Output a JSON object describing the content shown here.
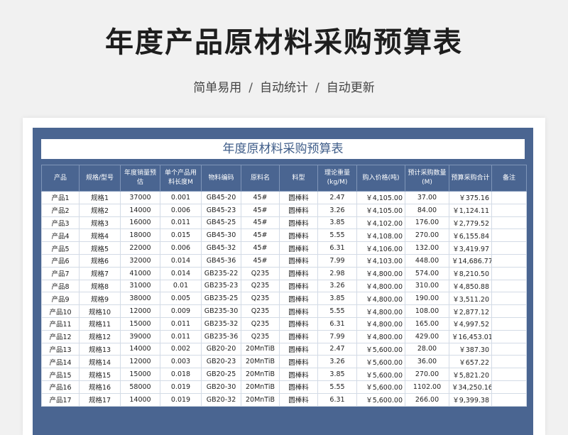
{
  "hero": {
    "title": "年度产品原材料采购预算表",
    "subtitle": [
      "简单易用",
      "自动统计",
      "自动更新"
    ],
    "separator": "/"
  },
  "sheet": {
    "title": "年度原材料采购预算表",
    "accent_color": "#4a6591",
    "columns": [
      "产品",
      "规格/型号",
      "年度销量预估",
      "单个产品用料长度M",
      "物料编码",
      "原料名",
      "料型",
      "理论重量(kg/M)",
      "购入价格(吨)",
      "预计采购数量(M)",
      "预算采购合计",
      "备注"
    ],
    "rows": [
      [
        "产品1",
        "规格1",
        "37000",
        "0.001",
        "GB45-20",
        "45#",
        "圆棒料",
        "2.47",
        "￥4,105.00",
        "37.00",
        "￥375.16",
        ""
      ],
      [
        "产品2",
        "规格2",
        "14000",
        "0.006",
        "GB45-23",
        "45#",
        "圆棒料",
        "3.26",
        "￥4,105.00",
        "84.00",
        "￥1,124.11",
        ""
      ],
      [
        "产品3",
        "规格3",
        "16000",
        "0.011",
        "GB45-25",
        "45#",
        "圆棒料",
        "3.85",
        "￥4,102.00",
        "176.00",
        "￥2,779.52",
        ""
      ],
      [
        "产品4",
        "规格4",
        "18000",
        "0.015",
        "GB45-30",
        "45#",
        "圆棒料",
        "5.55",
        "￥4,108.00",
        "270.00",
        "￥6,155.84",
        ""
      ],
      [
        "产品5",
        "规格5",
        "22000",
        "0.006",
        "GB45-32",
        "45#",
        "圆棒料",
        "6.31",
        "￥4,106.00",
        "132.00",
        "￥3,419.97",
        ""
      ],
      [
        "产品6",
        "规格6",
        "32000",
        "0.014",
        "GB45-36",
        "45#",
        "圆棒料",
        "7.99",
        "￥4,103.00",
        "448.00",
        "￥14,686.77",
        ""
      ],
      [
        "产品7",
        "规格7",
        "41000",
        "0.014",
        "GB235-22",
        "Q235",
        "圆棒料",
        "2.98",
        "￥4,800.00",
        "574.00",
        "￥8,210.50",
        ""
      ],
      [
        "产品8",
        "规格8",
        "31000",
        "0.01",
        "GB235-23",
        "Q235",
        "圆棒料",
        "3.26",
        "￥4,800.00",
        "310.00",
        "￥4,850.88",
        ""
      ],
      [
        "产品9",
        "规格9",
        "38000",
        "0.005",
        "GB235-25",
        "Q235",
        "圆棒料",
        "3.85",
        "￥4,800.00",
        "190.00",
        "￥3,511.20",
        ""
      ],
      [
        "产品10",
        "规格10",
        "12000",
        "0.009",
        "GB235-30",
        "Q235",
        "圆棒料",
        "5.55",
        "￥4,800.00",
        "108.00",
        "￥2,877.12",
        ""
      ],
      [
        "产品11",
        "规格11",
        "15000",
        "0.011",
        "GB235-32",
        "Q235",
        "圆棒料",
        "6.31",
        "￥4,800.00",
        "165.00",
        "￥4,997.52",
        ""
      ],
      [
        "产品12",
        "规格12",
        "39000",
        "0.011",
        "GB235-36",
        "Q235",
        "圆棒料",
        "7.99",
        "￥4,800.00",
        "429.00",
        "￥16,453.01",
        ""
      ],
      [
        "产品13",
        "规格13",
        "14000",
        "0.002",
        "GB20-20",
        "20MnTiB",
        "圆棒料",
        "2.47",
        "￥5,600.00",
        "28.00",
        "￥387.30",
        ""
      ],
      [
        "产品14",
        "规格14",
        "12000",
        "0.003",
        "GB20-23",
        "20MnTiB",
        "圆棒料",
        "3.26",
        "￥5,600.00",
        "36.00",
        "￥657.22",
        ""
      ],
      [
        "产品15",
        "规格15",
        "15000",
        "0.018",
        "GB20-25",
        "20MnTiB",
        "圆棒料",
        "3.85",
        "￥5,600.00",
        "270.00",
        "￥5,821.20",
        ""
      ],
      [
        "产品16",
        "规格16",
        "58000",
        "0.019",
        "GB20-30",
        "20MnTiB",
        "圆棒料",
        "5.55",
        "￥5,600.00",
        "1102.00",
        "￥34,250.16",
        ""
      ],
      [
        "产品17",
        "规格17",
        "14000",
        "0.019",
        "GB20-32",
        "20MnTiB",
        "圆棒料",
        "6.31",
        "￥5,600.00",
        "266.00",
        "￥9,399.38",
        ""
      ]
    ]
  }
}
